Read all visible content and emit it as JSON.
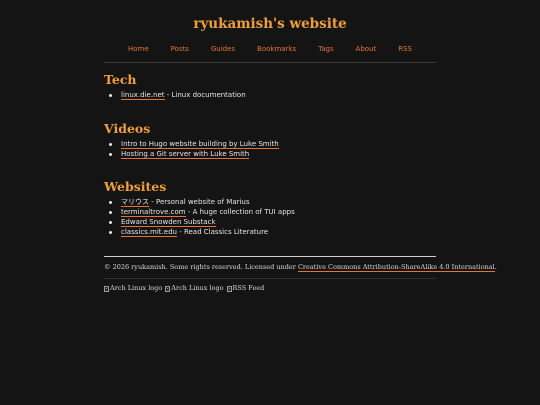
{
  "site": {
    "title": "ryukamish's website"
  },
  "nav": {
    "items": [
      {
        "label": "Home"
      },
      {
        "label": "Posts"
      },
      {
        "label": "Guides"
      },
      {
        "label": "Bookmarks"
      },
      {
        "label": "Tags"
      },
      {
        "label": "About"
      },
      {
        "label": "RSS"
      }
    ]
  },
  "sections": {
    "tech": {
      "heading": "Tech",
      "items": [
        {
          "link": "linux.die.net",
          "desc": " - Linux documentation"
        }
      ]
    },
    "videos": {
      "heading": "Videos",
      "items": [
        {
          "link": "Intro to Hugo website building by Luke Smith",
          "desc": ""
        },
        {
          "link": "Hosting a Git server with Luke Smith",
          "desc": ""
        }
      ]
    },
    "websites": {
      "heading": "Websites",
      "items": [
        {
          "link": "マリウス",
          "desc": " - Personal website of Marius"
        },
        {
          "link": "terminaltrove.com",
          "desc": " - A huge collection of TUI apps"
        },
        {
          "link": "Edward Snowden Substack",
          "desc": ""
        },
        {
          "link": "classics.mit.edu",
          "desc": " - Read Classics Literature"
        }
      ]
    }
  },
  "footer": {
    "copyright": "© 2026 ryukamish. Some rights reserved. Licensed under ",
    "license_link": "Creative Commons Attribution-ShareAlike 4.0 International",
    "period": ".",
    "badges": [
      {
        "alt": "Arch Linux logo"
      },
      {
        "alt": "Arch Linux logo"
      },
      {
        "alt": "RSS Feed"
      }
    ]
  },
  "colors": {
    "background": "#141414",
    "heading": "#f0a030",
    "accent": "#e8742c",
    "text": "#e6e6e6"
  }
}
